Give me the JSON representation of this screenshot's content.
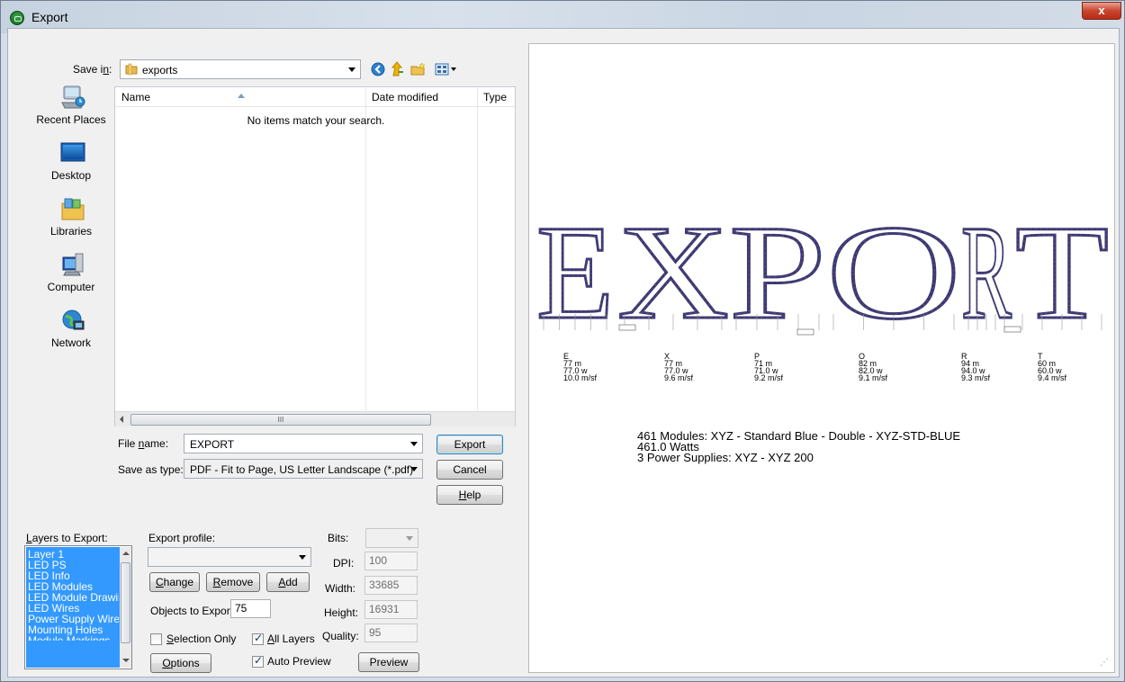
{
  "window": {
    "title": "Export",
    "close_glyph": "x"
  },
  "save_in": {
    "label": "Save in:",
    "folder": "exports"
  },
  "places": [
    {
      "label": "Recent Places",
      "icon": "recent-places-icon"
    },
    {
      "label": "Desktop",
      "icon": "desktop-icon"
    },
    {
      "label": "Libraries",
      "icon": "libraries-icon"
    },
    {
      "label": "Computer",
      "icon": "computer-icon"
    },
    {
      "label": "Network",
      "icon": "network-icon"
    }
  ],
  "file_list": {
    "columns": [
      "Name",
      "Date modified",
      "Type"
    ],
    "empty_message": "No items match your search.",
    "scroll_grip": "III"
  },
  "file_name": {
    "label": "File name:",
    "value": "EXPORT"
  },
  "save_as_type": {
    "label": "Save as type:",
    "value": "PDF - Fit to Page, US Letter Landscape (*.pdf)"
  },
  "buttons": {
    "export": "Export",
    "cancel": "Cancel",
    "help": "Help"
  },
  "layers": {
    "label": "Layers to Export:",
    "items": [
      "Layer 1",
      "LED PS",
      "LED Info",
      "LED Modules",
      "LED Module Drawing",
      "LED Wires",
      "Power Supply Wires",
      "Mounting Holes",
      "Module Markings"
    ]
  },
  "export_profile": {
    "label": "Export profile:",
    "value": "",
    "change": "Change",
    "remove": "Remove",
    "add": "Add",
    "objects_label": "Objects to Export:",
    "objects_value": "75",
    "selection_only": "Selection Only",
    "all_layers": "All Layers",
    "options": "Options",
    "auto_preview": "Auto Preview",
    "preview": "Preview",
    "selection_only_checked": false,
    "all_layers_checked": true,
    "auto_preview_checked": true
  },
  "image_settings": {
    "bits_label": "Bits:",
    "dpi_label": "DPI:",
    "dpi": "100",
    "width_label": "Width:",
    "width": "33685",
    "height_label": "Height:",
    "height": "16931",
    "quality_label": "Quality:",
    "quality": "95"
  },
  "preview": {
    "word": "EXPORT",
    "letters": [
      {
        "letter": "E",
        "modules": "77 m",
        "watts": "77.0 w",
        "density": "10.0 m/sf"
      },
      {
        "letter": "X",
        "modules": "77 m",
        "watts": "77.0 w",
        "density": "9.6 m/sf"
      },
      {
        "letter": "P",
        "modules": "71 m",
        "watts": "71.0 w",
        "density": "9.2 m/sf"
      },
      {
        "letter": "O",
        "modules": "82 m",
        "watts": "82.0 w",
        "density": "9.1 m/sf"
      },
      {
        "letter": "R",
        "modules": "94 m",
        "watts": "94.0 w",
        "density": "9.3 m/sf"
      },
      {
        "letter": "T",
        "modules": "60 m",
        "watts": "60.0 w",
        "density": "9.4 m/sf"
      }
    ],
    "summary": [
      "461 Modules: XYZ - Standard Blue - Double - XYZ-STD-BLUE",
      "461.0 Watts",
      "3 Power Supplies: XYZ - XYZ 200"
    ]
  },
  "colors": {
    "selection": "#3399ff",
    "outline": "#3a3a6a",
    "led_dot": "#5b3fa0"
  }
}
